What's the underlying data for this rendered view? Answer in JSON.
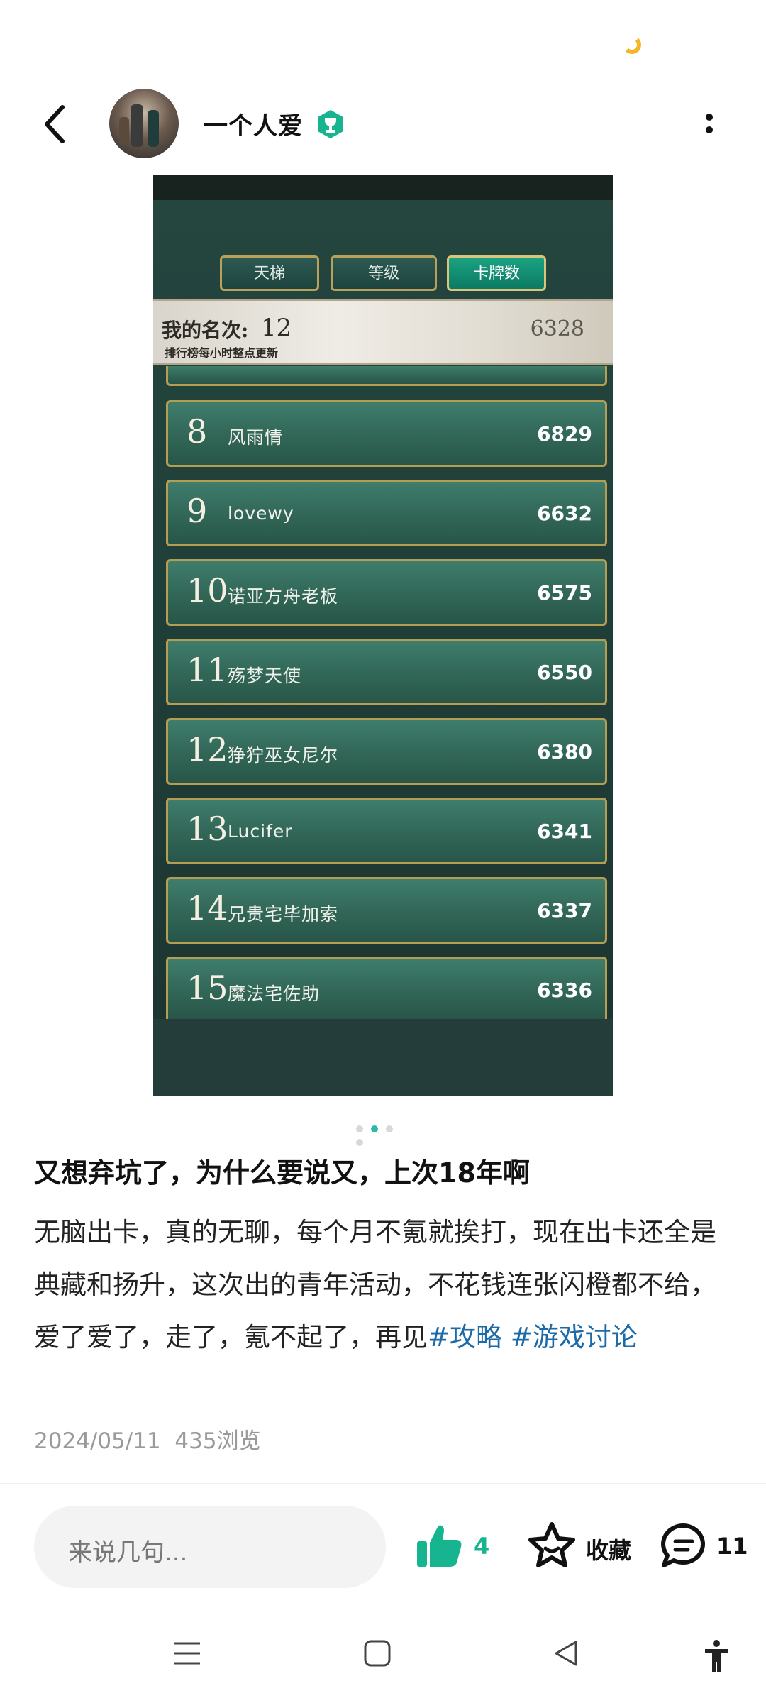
{
  "header": {
    "username": "一个人爱",
    "icons": [
      "back-arrow-icon",
      "avatar",
      "trophy-badge-icon",
      "more-vertical-icon"
    ]
  },
  "screenshot": {
    "tabs": [
      {
        "label": "天梯",
        "active": false
      },
      {
        "label": "等级",
        "active": false
      },
      {
        "label": "卡牌数",
        "active": true
      }
    ],
    "my_rank_label": "我的名次:",
    "my_rank_value": "12",
    "my_rank_note": "排行榜每小时整点更新",
    "my_score": "6328",
    "rows": [
      {
        "rank": "8",
        "name": "风雨情",
        "score": "6829"
      },
      {
        "rank": "9",
        "name": "lovewy",
        "score": "6632"
      },
      {
        "rank": "10",
        "name": "诺亚方舟老板",
        "score": "6575"
      },
      {
        "rank": "11",
        "name": "殇梦天使",
        "score": "6550"
      },
      {
        "rank": "12",
        "name": "狰狞巫女尼尔",
        "score": "6380"
      },
      {
        "rank": "13",
        "name": "Lucifer",
        "score": "6341"
      },
      {
        "rank": "14",
        "name": "兄贵宅毕加索",
        "score": "6337"
      },
      {
        "rank": "15",
        "name": "魔法宅佐助",
        "score": "6336"
      }
    ]
  },
  "pagination": {
    "count": 4,
    "active_index": 1
  },
  "post": {
    "title": "又想弃坑了，为什么要说又，上次18年啊",
    "body": "无脑出卡，真的无聊，每个月不氪就挨打，现在出卡还全是典藏和扬升，这次出的青年活动，不花钱连张闪橙都不给，爱了爱了，走了，氪不起了，再见",
    "tags": [
      "#攻略",
      "#游戏讨论"
    ],
    "date": "2024/05/11",
    "views": "435浏览"
  },
  "actions": {
    "comment_placeholder": "来说几句...",
    "like_count": "4",
    "favorite_label": "收藏",
    "comment_count": "11",
    "accent_color": "#17b58f"
  },
  "system_nav": {
    "icons": [
      "menu-icon",
      "home-square-icon",
      "back-triangle-icon",
      "accessibility-icon"
    ]
  }
}
